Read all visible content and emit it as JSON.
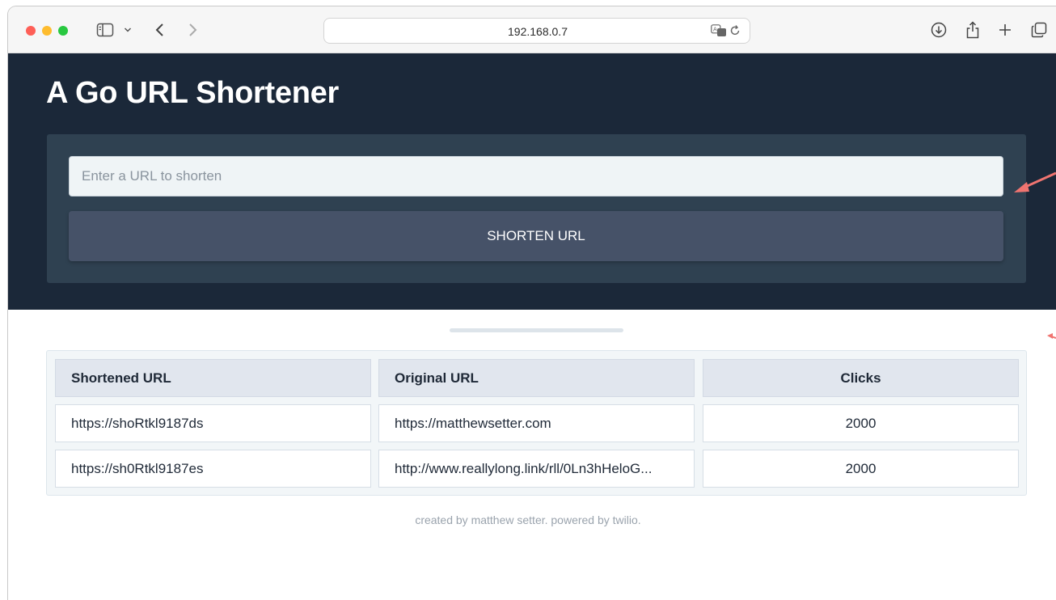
{
  "browser": {
    "address": "192.168.0.7"
  },
  "app": {
    "title": "A Go URL Shortener"
  },
  "form": {
    "input_placeholder": "Enter a URL to shorten",
    "input_value": "",
    "button_label": "SHORTEN URL"
  },
  "table": {
    "headers": [
      "Shortened URL",
      "Original URL",
      "Clicks"
    ],
    "rows": [
      {
        "short": "https://shoRtkl9187ds",
        "original": "https://matthewsetter.com",
        "clicks": "2000"
      },
      {
        "short": "https://sh0Rtkl9187es",
        "original": "http://www.reallylong.link/rll/0Ln3hHeloG...",
        "clicks": "2000"
      }
    ]
  },
  "footer": {
    "text": "created by matthew setter. powered by twilio."
  },
  "colors": {
    "hero_bg": "#1b2839",
    "card_bg": "#2f4151",
    "button_bg": "#465268",
    "annotation": "#f07470"
  }
}
